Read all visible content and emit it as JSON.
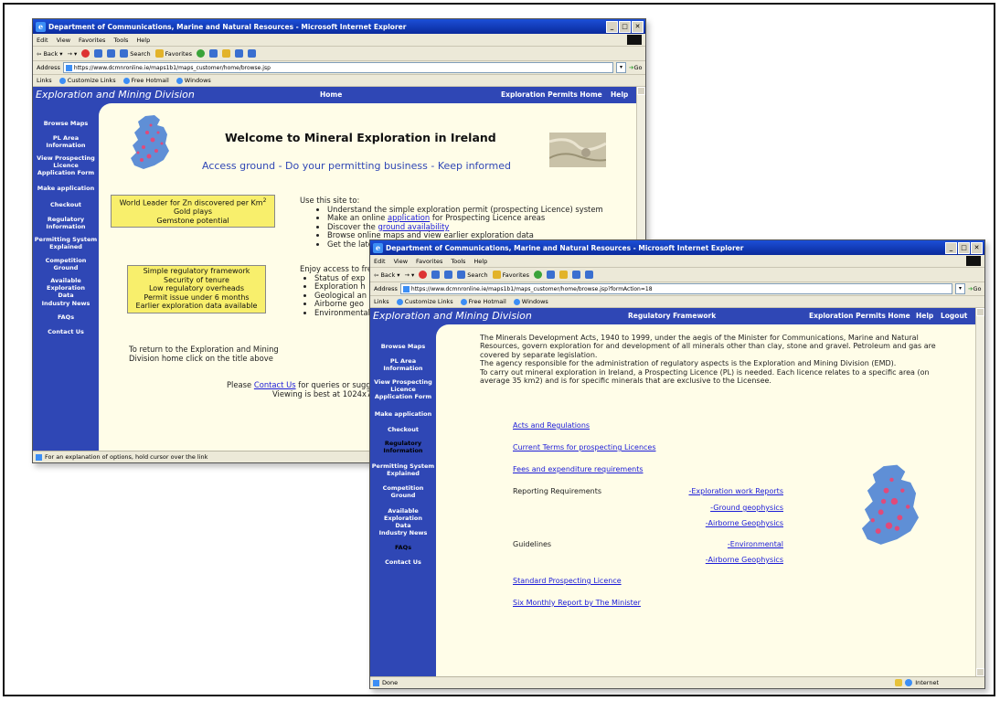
{
  "window1": {
    "title": "Department of Communications, Marine and Natural Resources - Microsoft Internet Explorer",
    "menu": [
      "Edit",
      "View",
      "Favorites",
      "Tools",
      "Help"
    ],
    "toolbar": {
      "back": "Back",
      "search": "Search",
      "favorites": "Favorites"
    },
    "address_label": "Address",
    "url": "https://www.dcmnronline.ie/maps1b1/maps_customer/home/browse.jsp",
    "go": "Go",
    "links_label": "Links",
    "links": [
      "Customize Links",
      "Free Hotmail",
      "Windows"
    ],
    "brand": "Exploration and Mining Division",
    "nav_home": "Home",
    "nav_permits": "Exploration Permits Home",
    "nav_help": "Help",
    "sidebar": [
      "Browse Maps",
      "PL Area Information",
      "View Prospecting Licence Application Form",
      "Make application",
      "Checkout",
      "Regulatory Information",
      "Permitting System Explained",
      "Competition Ground",
      "Available Exploration Data",
      "Industry News",
      "FAQs",
      "Contact Us"
    ],
    "heading": "Welcome to Mineral Exploration in Ireland",
    "tagline": "Access ground - Do your permitting business - Keep informed",
    "box1": {
      "line1_pre": "World Leader for Zn discovered per Km",
      "line1_sup": "2",
      "line2": "Gold plays",
      "line3": "Gemstone potential"
    },
    "box2": [
      "Simple regulatory framework",
      "Security of tenure",
      "Low regulatory overheads",
      "Permit issue under 6 months",
      "Earlier exploration data available"
    ],
    "use_site": "Use this site to:",
    "bullets": {
      "b1": "Understand the simple exploration permit (prospecting Licence) system",
      "b2_pre": "Make an online ",
      "b2_link": "application",
      "b2_post": " for Prospecting Licence areas",
      "b3_pre": "Discover the ",
      "b3_link": "ground availability",
      "b4": "Browse online maps and view earlier exploration data",
      "b5": "Get the latest"
    },
    "enjoy": "Enjoy access to free",
    "bullets2": [
      "Status of exp",
      "Exploration h",
      "Geological an",
      "Airborne geo",
      "Environmental"
    ],
    "return_text": "To return to the Exploration and Mining Division home click on the title above",
    "contact_pre": "Please ",
    "contact_link": "Contact Us",
    "contact_post": " for queries or sugg",
    "viewing": "Viewing is best at 1024x7",
    "status": "For an explanation of options, hold cursor over the link"
  },
  "window2": {
    "title": "Department of Communications, Marine and Natural Resources - Microsoft Internet Explorer",
    "menu": [
      "Edit",
      "View",
      "Favorites",
      "Tools",
      "Help"
    ],
    "toolbar": {
      "back": "Back",
      "search": "Search",
      "favorites": "Favorites"
    },
    "address_label": "Address",
    "url": "https://www.dcmnronline.ie/maps1b1/maps_customer/home/browse.jsp?formAction=18",
    "go": "Go",
    "links_label": "Links",
    "links": [
      "Customize Links",
      "Free Hotmail",
      "Windows"
    ],
    "brand": "Exploration and Mining Division",
    "nav_section": "Regulatory Framework",
    "nav_permits": "Exploration Permits Home",
    "nav_help": "Help",
    "nav_logout": "Logout",
    "sidebar": [
      "Browse Maps",
      "PL Area Information",
      "View Prospecting Licence Application Form",
      "Make application",
      "Checkout",
      "Regulatory Information",
      "Permitting System Explained",
      "Competition Ground",
      "Available Exploration Data",
      "Industry News",
      "FAQs",
      "Contact Us"
    ],
    "intro": {
      "p1": "The Minerals Development Acts, 1940 to 1999, under the aegis of the Minister for Communications, Marine and Natural Resources, govern exploration for and development of all minerals other than clay, stone and gravel. Petroleum and gas are covered by separate legislation.",
      "p2": "The agency responsible for the administration of regulatory aspects is the Exploration and Mining Division (EMD).",
      "p3": "To carry out mineral exploration in Ireland, a Prospecting Licence (PL) is needed. Each licence relates to a specific area (on average 35 km2) and is for specific minerals that are exclusive to the Licensee."
    },
    "link_acts": "Acts and Regulations",
    "link_terms": "Current Terms for prospecting Licences",
    "link_fees": "Fees and expenditure requirements",
    "reporting_label": "Reporting Requirements",
    "reporting_links": [
      "-Exploration work Reports",
      "-Ground geophysics",
      "-Airborne Geophysics"
    ],
    "guidelines_label": "Guidelines",
    "guidelines_links": [
      "-Environmental",
      "-Airborne Geophysics"
    ],
    "link_licence": "Standard Prospecting Licence",
    "link_report": "Six Monthly Report by The Minister",
    "status_done": "Done",
    "status_zone": "Internet"
  }
}
